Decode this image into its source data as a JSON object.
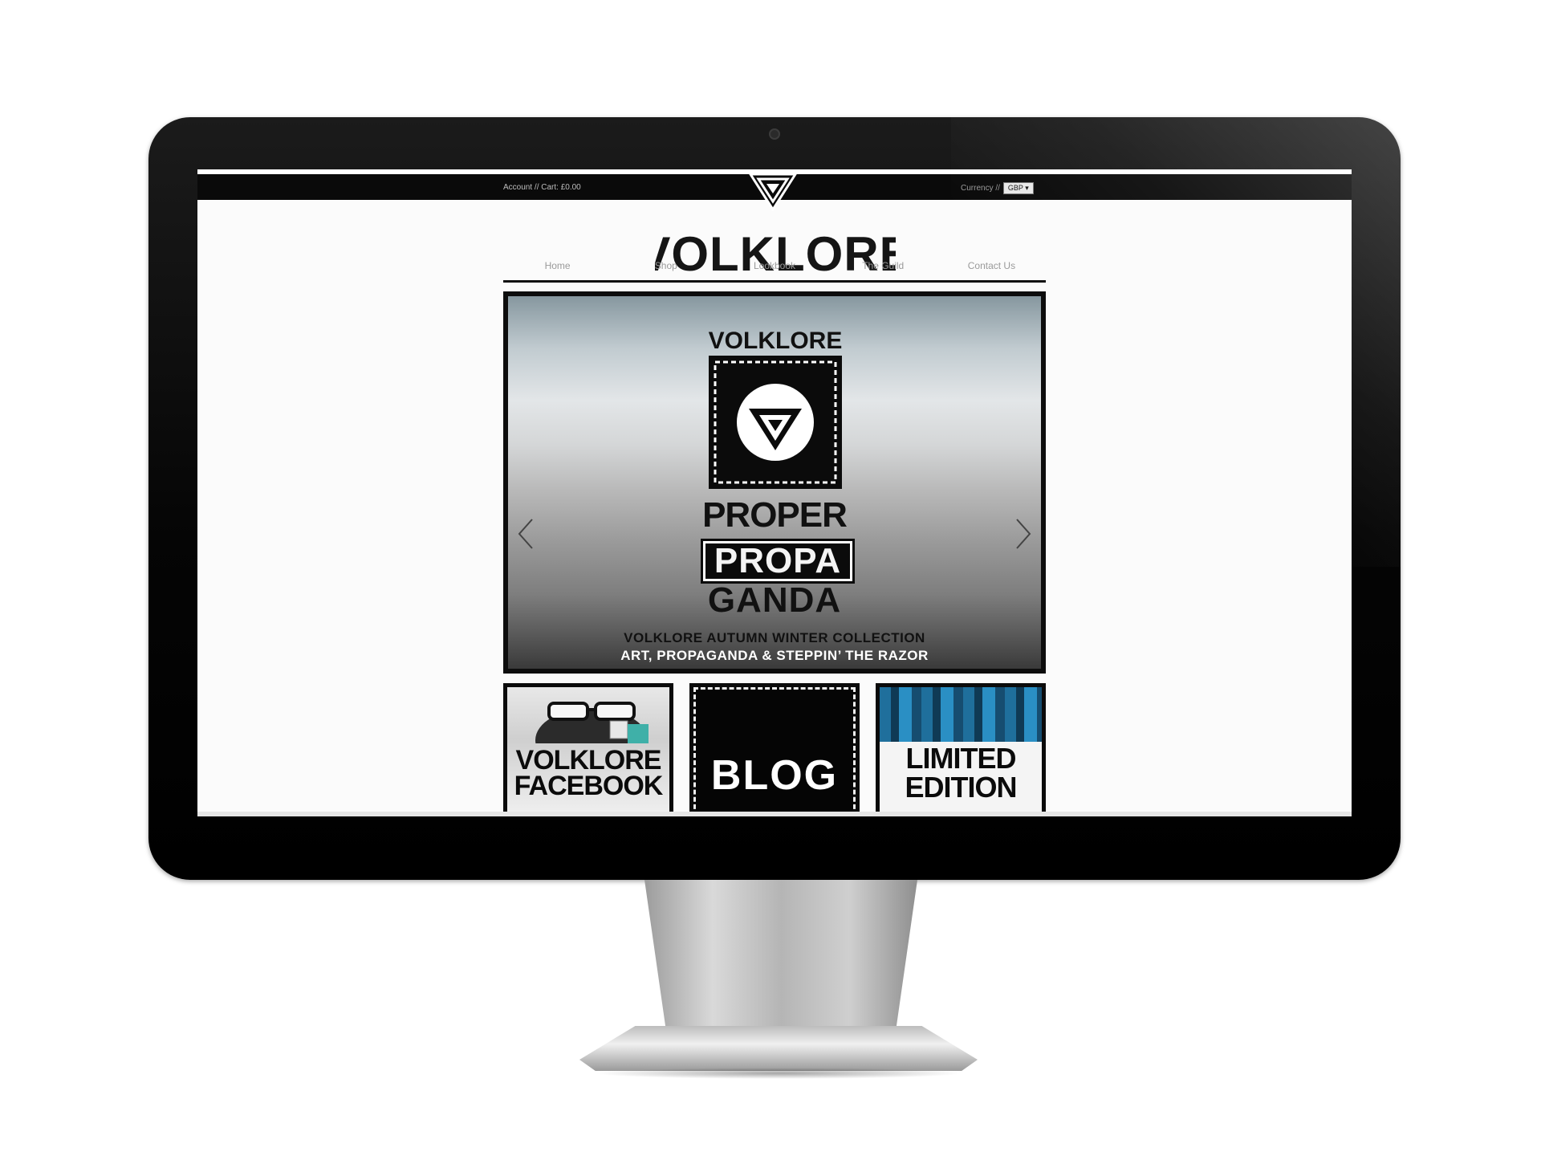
{
  "topbar": {
    "account_cart": "Account // Cart: £0.00",
    "currency_label": "Currency //",
    "currency_value": "GBP ▾"
  },
  "site": {
    "wordmark": "VOLKLORE"
  },
  "nav": {
    "items": [
      "Home",
      "Shop",
      "Lookbook",
      "The Guild",
      "Contact Us"
    ]
  },
  "hero": {
    "brand": "VOLKLORE",
    "line1": "PROPER",
    "line2": "PROPA",
    "line3": "GANDA",
    "caption1": "VOLKLORE AUTUMN WINTER COLLECTION",
    "caption2": "ART, PROPAGANDA & STEPPIN’ THE RAZOR"
  },
  "tiles": [
    {
      "line1": "VOLKLORE",
      "line2": "FACEBOOK"
    },
    {
      "line1": "BLOG"
    },
    {
      "line1": "LIMITED",
      "line2": "EDITION"
    }
  ],
  "colors": {
    "bezel": "#050505",
    "screen_bg": "#fbfbfb",
    "nav_text": "#9a9a9a",
    "accent_blue": "#1f6f9c"
  },
  "icons": [
    "triangle-logo-icon",
    "chevron-left-icon",
    "chevron-right-icon",
    "webcam-icon"
  ]
}
